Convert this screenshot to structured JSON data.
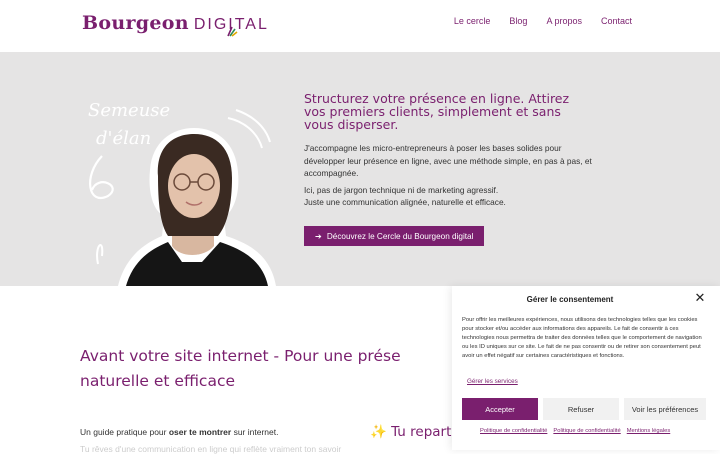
{
  "header": {
    "logo_word": "Bourgeon",
    "logo_sub": "DIGITAL",
    "nav": [
      "Le cercle",
      "Blog",
      "A propos",
      "Contact"
    ]
  },
  "hero": {
    "script_text_1": "Semeuse",
    "script_text_2": "d'élan",
    "title": "Structurez votre présence en ligne. Attirez vos premiers clients, simplement et sans vous disperser.",
    "p1": "J'accompagne les micro-entrepreneurs à poser les bases solides pour développer leur présence en ligne, avec une méthode simple, en pas à pas, et accompagnée.",
    "p2_line1": "Ici, pas de jargon technique ni de marketing agressif.",
    "p2_line2": "Juste une communication alignée, naturelle et efficace.",
    "cta_icon": "arrow-right-icon",
    "cta_label": "Découvrez le Cercle du Bourgeon digital"
  },
  "section": {
    "title_line1": "Avant votre site internet - Pour une prése",
    "title_line2": "naturelle et efficace",
    "guide_pre": "Un guide pratique pour ",
    "guide_bold": "oser te montrer",
    "guide_post": " sur internet.",
    "faded": "Tu rêves d'une communication en ligne qui reflète vraiment ton savoir",
    "sparkle": "✨",
    "tu_repart": "Tu repart"
  },
  "consent": {
    "title": "Gérer le consentement",
    "body": "Pour offrir les meilleures expériences, nous utilisons des technologies telles que les cookies pour stocker et/ou accéder aux informations des appareils. Le fait de consentir à ces technologies nous permettra de traiter des données telles que le comportement de navigation ou les ID uniques sur ce site. Le fait de ne pas consentir ou de retirer son consentement peut avoir un effet négatif sur certaines caractéristiques et fonctions.",
    "manage_services": "Gérer les services",
    "accept": "Accepter",
    "refuse": "Refuser",
    "prefs": "Voir les préférences",
    "footer_links": [
      "Politique de confidentialité",
      "Politique de confidentialité",
      "Mentions légales"
    ]
  },
  "colors": {
    "brand": "#7a1f6e",
    "hero_bg": "#e5e4e4"
  }
}
